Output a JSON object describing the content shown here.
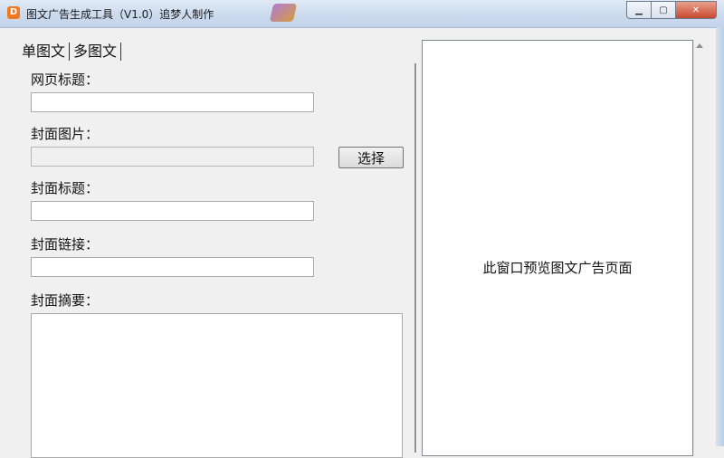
{
  "window": {
    "title": "图文广告生成工具（V1.0）追梦人制作",
    "icon_letter": "D",
    "buttons": {
      "minimize": "minimize-icon",
      "maximize": "maximize-icon",
      "close": "close-icon"
    }
  },
  "tabs": [
    {
      "label": "单图文",
      "selected": true
    },
    {
      "label": "多图文",
      "selected": false
    }
  ],
  "form": {
    "page_title_label": "网页标题：",
    "page_title_value": "",
    "cover_image_label": "封面图片：",
    "cover_image_value": "",
    "choose_button": "选择",
    "cover_title_label": "封面标题：",
    "cover_title_value": "",
    "cover_link_label": "封面链接：",
    "cover_link_value": "",
    "cover_summary_label": "封面摘要：",
    "cover_summary_value": ""
  },
  "preview": {
    "placeholder": "此窗口预览图文广告页面"
  }
}
